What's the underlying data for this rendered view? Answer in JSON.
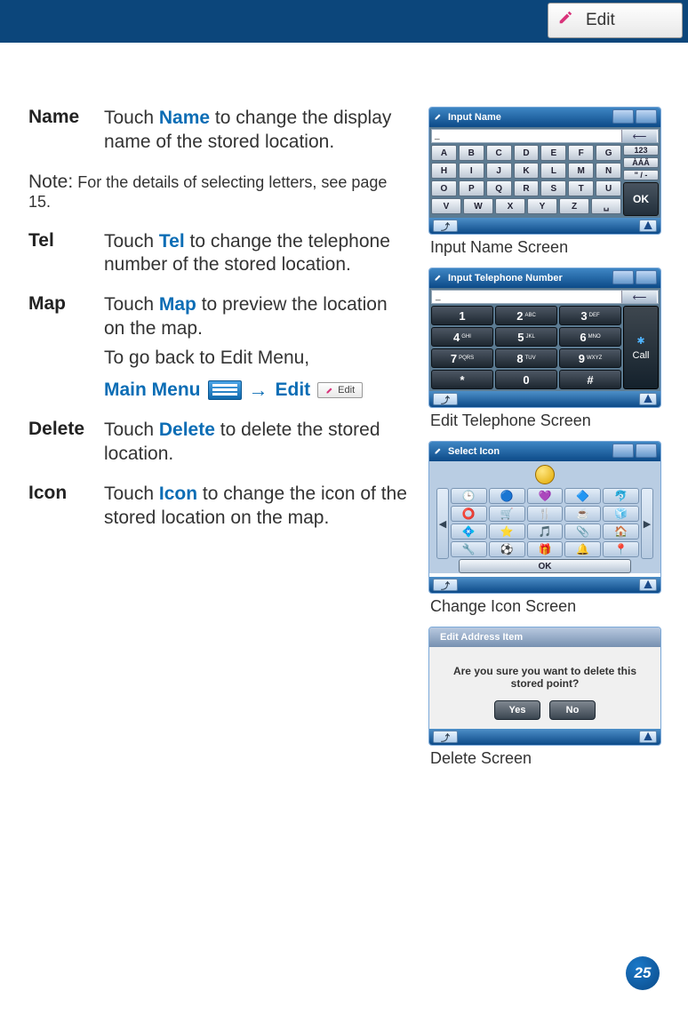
{
  "header": {
    "edit_label": "Edit"
  },
  "defs": {
    "name": {
      "term": "Name",
      "kw": "Name",
      "rest": " to change the display name of the stored location.",
      "touch": "Touch "
    },
    "note": {
      "label": "Note:",
      "text": " For the details of selecting letters, see page 15."
    },
    "tel": {
      "term": "Tel",
      "kw": "Tel",
      "rest": " to change the telephone number of the stored location.",
      "touch": "Touch "
    },
    "map": {
      "term": "Map",
      "kw": "Map",
      "rest": " to preview the location on the map.",
      "touch": "Touch ",
      "sub": "To go back to Edit Menu,",
      "mm": "Main Menu",
      "edit": "Edit"
    },
    "del": {
      "term": "Delete",
      "kw": "Delete",
      "rest": " to delete the stored location.",
      "touch": "Touch "
    },
    "icon": {
      "term": "Icon",
      "kw": "Icon",
      "rest": " to change the icon of the stored location on the map.",
      "touch": "Touch "
    }
  },
  "screens": {
    "input_name": {
      "title": "Input Name",
      "caption": "Input Name Screen",
      "keys": {
        "row1": [
          "A",
          "B",
          "C",
          "D",
          "E",
          "F",
          "G"
        ],
        "row2": [
          "H",
          "I",
          "J",
          "K",
          "L",
          "M",
          "N"
        ],
        "row3": [
          "O",
          "P",
          "Q",
          "R",
          "S",
          "T",
          "U"
        ],
        "row4": [
          "V",
          "W",
          "X",
          "Y",
          "Z",
          "␣"
        ],
        "side1": "123",
        "side2": "ÀÁÂ",
        "side3": "\" / -",
        "ok": "OK",
        "cursor": "_"
      }
    },
    "tel": {
      "title": "Input Telephone Number",
      "caption": "Edit Telephone Screen",
      "keys": {
        "r1": [
          [
            "1",
            ""
          ],
          [
            "2",
            "ABC"
          ],
          [
            "3",
            "DEF"
          ]
        ],
        "r2": [
          [
            "4",
            "GHI"
          ],
          [
            "5",
            "JKL"
          ],
          [
            "6",
            "MNO"
          ]
        ],
        "r3": [
          [
            "7",
            "PQRS"
          ],
          [
            "8",
            "TUV"
          ],
          [
            "9",
            "WXYZ"
          ]
        ],
        "r4": [
          [
            "*",
            ""
          ],
          [
            "0",
            ""
          ],
          [
            "#",
            ""
          ]
        ],
        "call": "Call",
        "cursor": "_"
      }
    },
    "icon": {
      "title": "Select Icon",
      "caption": "Change Icon Screen",
      "ok": "OK",
      "grid": [
        [
          "🕒",
          "🔵",
          "💜",
          "🔷",
          "🐬"
        ],
        [
          "⭕",
          "🛒",
          "🍴",
          "☕",
          "🧊"
        ],
        [
          "💠",
          "⭐",
          "🎵",
          "📎",
          "🏠"
        ],
        [
          "🔧",
          "⚽",
          "🎁",
          "🔔",
          "📍"
        ]
      ]
    },
    "del": {
      "title": "Edit Address Item",
      "caption": "Delete Screen",
      "message": "Are you sure you want to delete this stored point?",
      "yes": "Yes",
      "no": "No"
    }
  },
  "page_number": "25"
}
